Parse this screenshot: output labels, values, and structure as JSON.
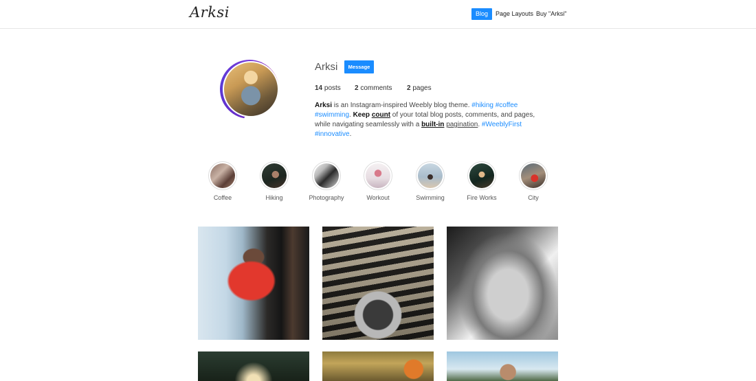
{
  "header": {
    "logo": "Arksi",
    "nav": [
      {
        "label": "Blog",
        "active": true
      },
      {
        "label": "Page Layouts",
        "active": false
      },
      {
        "label": "Buy \"Arksi\"",
        "active": false
      }
    ]
  },
  "profile": {
    "name": "Arksi",
    "message_label": "Message",
    "stats": [
      {
        "count": "14",
        "label": "posts"
      },
      {
        "count": "2",
        "label": "comments"
      },
      {
        "count": "2",
        "label": "pages"
      }
    ],
    "bio": {
      "name": "Arksi",
      "text1": " is an Instagram-inspired Weebly blog theme. ",
      "tag1": "#hiking",
      "tag2": "#coffee",
      "tag3": "#swimming",
      "text2": ". ",
      "keep": "Keep",
      "count": "count",
      "text3": " of your total blog posts, comments, and pages, while navigating seamlessly with a ",
      "builtin": "built-in",
      "pagination": "pagination",
      "text4": ". ",
      "tag4": "#WeeblyFirst",
      "tag5": "#innovative",
      "text5": "."
    }
  },
  "highlights": [
    {
      "label": "Coffee"
    },
    {
      "label": "Hiking"
    },
    {
      "label": "Photography"
    },
    {
      "label": "Workout"
    },
    {
      "label": "Swimming"
    },
    {
      "label": "Fire Works"
    },
    {
      "label": "City"
    }
  ],
  "colors": {
    "accent": "#1a8cff",
    "text": "#333333"
  }
}
